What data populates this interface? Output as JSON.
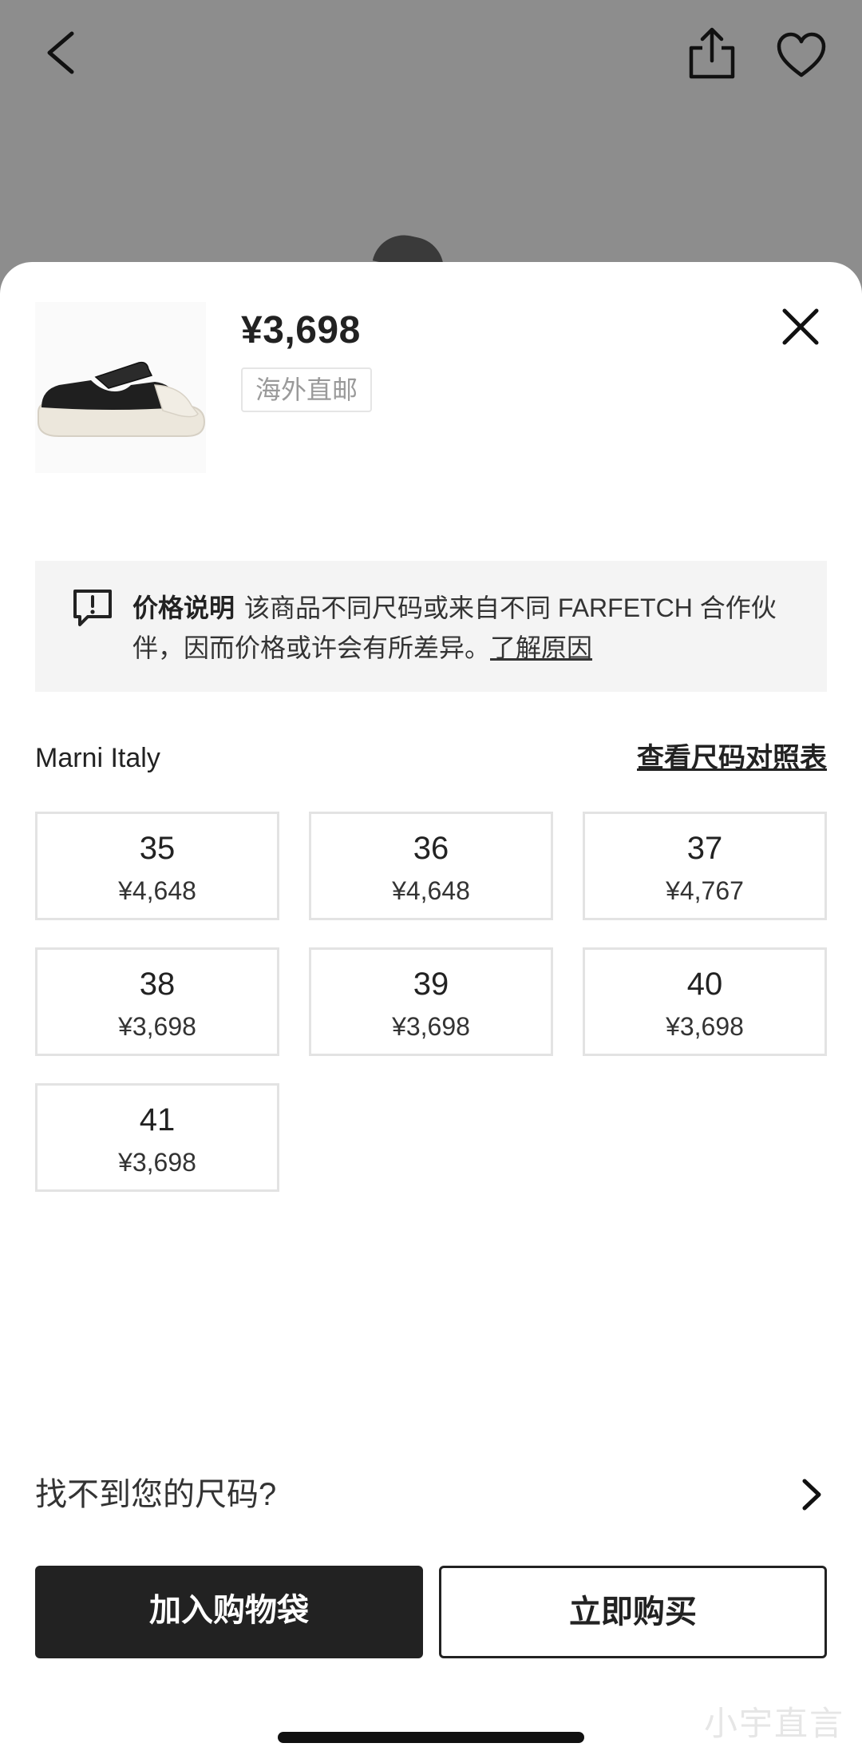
{
  "product": {
    "price": "¥3,698",
    "shipping_tag": "海外直邮"
  },
  "notice": {
    "title": "价格说明",
    "text": "该商品不同尺码或来自不同 FARFETCH 合作伙伴，因而价格或许会有所差异。",
    "link": "了解原因"
  },
  "sizes_section": {
    "brand": "Marni Italy",
    "size_chart_link": "查看尺码对照表",
    "sizes": [
      {
        "size": "35",
        "price": "¥4,648"
      },
      {
        "size": "36",
        "price": "¥4,648"
      },
      {
        "size": "37",
        "price": "¥4,767"
      },
      {
        "size": "38",
        "price": "¥3,698"
      },
      {
        "size": "39",
        "price": "¥3,698"
      },
      {
        "size": "40",
        "price": "¥3,698"
      },
      {
        "size": "41",
        "price": "¥3,698"
      }
    ]
  },
  "no_size": {
    "label": "找不到您的尺码?"
  },
  "buttons": {
    "add_to_bag": "加入购物袋",
    "buy_now": "立即购买"
  },
  "watermark": "小宇直言",
  "icons": [
    "back-icon",
    "share-icon",
    "heart-icon",
    "close-icon",
    "message-icon",
    "chevron-right-icon"
  ]
}
